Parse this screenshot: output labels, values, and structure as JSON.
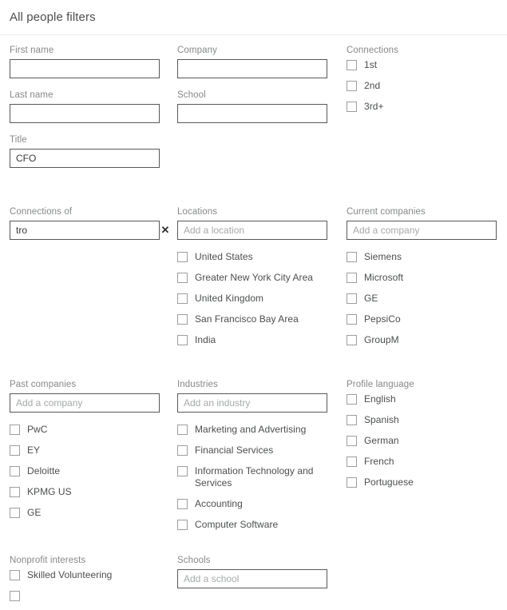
{
  "header": {
    "title": "All people filters"
  },
  "row1": {
    "first_name": {
      "label": "First name",
      "value": "",
      "placeholder": ""
    },
    "last_name": {
      "label": "Last name",
      "value": "",
      "placeholder": ""
    },
    "title_field": {
      "label": "Title",
      "value": "CFO",
      "placeholder": ""
    },
    "company": {
      "label": "Company",
      "value": "",
      "placeholder": ""
    },
    "school": {
      "label": "School",
      "value": "",
      "placeholder": ""
    },
    "connections": {
      "label": "Connections",
      "options": [
        {
          "label": "1st",
          "checked": false
        },
        {
          "label": "2nd",
          "checked": false
        },
        {
          "label": "3rd+",
          "checked": false
        }
      ]
    }
  },
  "row2": {
    "connections_of": {
      "label": "Connections of",
      "value": "tro",
      "placeholder": "",
      "clear_icon": "close-icon",
      "clear_glyph": "✕"
    },
    "locations": {
      "label": "Locations",
      "placeholder": "Add a location",
      "value": "",
      "options": [
        {
          "label": "United States",
          "checked": false
        },
        {
          "label": "Greater New York City Area",
          "checked": false
        },
        {
          "label": "United Kingdom",
          "checked": false
        },
        {
          "label": "San Francisco Bay Area",
          "checked": false
        },
        {
          "label": "India",
          "checked": false
        }
      ]
    },
    "current_companies": {
      "label": "Current companies",
      "placeholder": "Add a company",
      "value": "",
      "options": [
        {
          "label": "Siemens",
          "checked": false
        },
        {
          "label": "Microsoft",
          "checked": false
        },
        {
          "label": "GE",
          "checked": false
        },
        {
          "label": "PepsiCo",
          "checked": false
        },
        {
          "label": "GroupM",
          "checked": false
        }
      ]
    }
  },
  "row3": {
    "past_companies": {
      "label": "Past companies",
      "placeholder": "Add a company",
      "value": "",
      "options": [
        {
          "label": "PwC",
          "checked": false
        },
        {
          "label": "EY",
          "checked": false
        },
        {
          "label": "Deloitte",
          "checked": false
        },
        {
          "label": "KPMG US",
          "checked": false
        },
        {
          "label": "GE",
          "checked": false
        }
      ]
    },
    "industries": {
      "label": "Industries",
      "placeholder": "Add an industry",
      "value": "",
      "options": [
        {
          "label": "Marketing and Advertising",
          "checked": false
        },
        {
          "label": "Financial Services",
          "checked": false
        },
        {
          "label": "Information Technology and Services",
          "checked": false
        },
        {
          "label": "Accounting",
          "checked": false
        },
        {
          "label": "Computer Software",
          "checked": false
        }
      ]
    },
    "profile_language": {
      "label": "Profile language",
      "options": [
        {
          "label": "English",
          "checked": false
        },
        {
          "label": "Spanish",
          "checked": false
        },
        {
          "label": "German",
          "checked": false
        },
        {
          "label": "French",
          "checked": false
        },
        {
          "label": "Portuguese",
          "checked": false
        }
      ]
    }
  },
  "row4": {
    "nonprofit_interests": {
      "label": "Nonprofit interests",
      "options": [
        {
          "label": "Skilled Volunteering",
          "checked": false
        },
        {
          "label": "",
          "checked": false
        }
      ]
    },
    "schools": {
      "label": "Schools",
      "placeholder": "Add a school",
      "value": ""
    }
  },
  "colors": {
    "text": "#37383a",
    "label": "#86888a",
    "border": "#58585a",
    "checkbox_border": "#9c9ea0",
    "divider": "#eceded"
  }
}
